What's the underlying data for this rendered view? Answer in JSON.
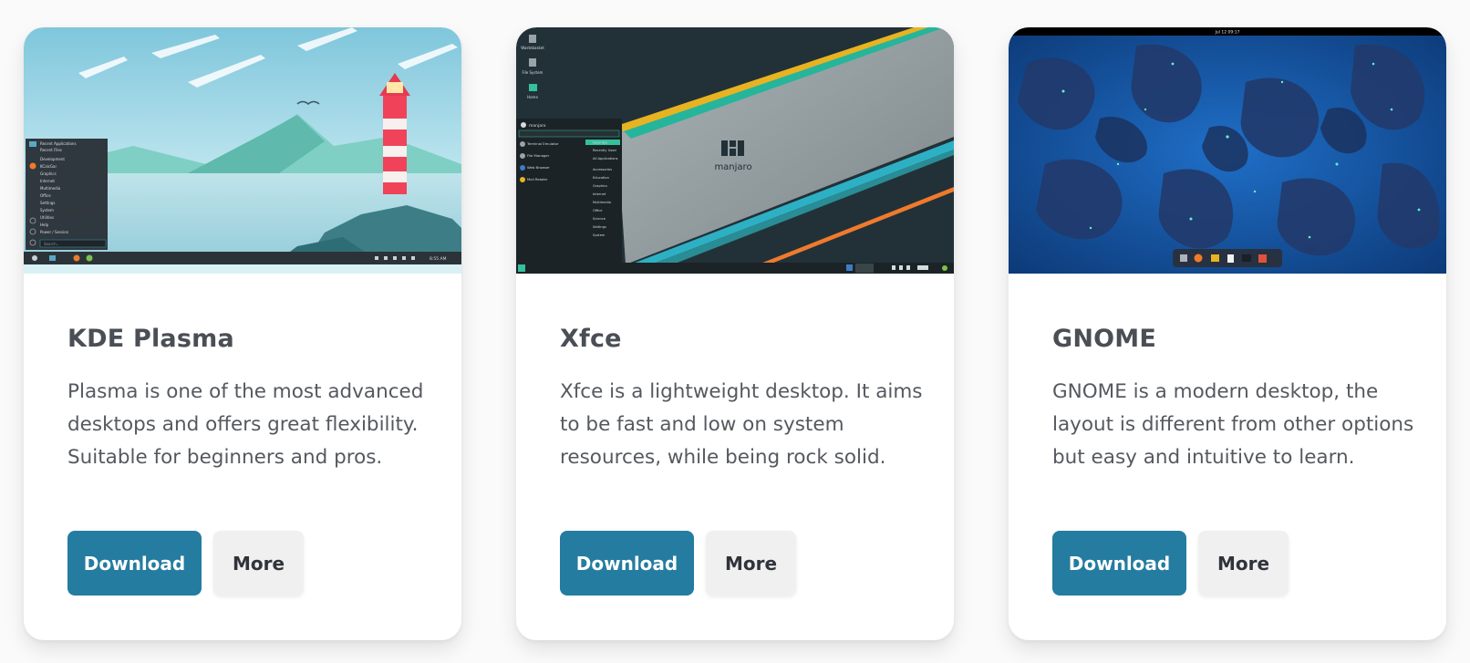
{
  "cards": [
    {
      "title": "KDE Plasma",
      "description": "Plasma is one of the most advanced desktops and offers great flexibility. Suitable for beginners and pros.",
      "download_label": "Download",
      "more_label": "More",
      "screenshot": {
        "menu_items": [
          "Recent Applications",
          "Recent Files",
          "Development",
          "KCalcGar",
          "Graphics",
          "Internet",
          "Multimedia",
          "Office",
          "Settings",
          "System",
          "Utilities",
          "Help",
          "Power / Session"
        ],
        "search_placeholder": "Search...",
        "clock": "8:55 AM"
      }
    },
    {
      "title": "Xfce",
      "description": "Xfce is a lightweight desktop. It aims to be fast and low on system resources, while being rock solid.",
      "download_label": "Download",
      "more_label": "More",
      "screenshot": {
        "desktop_icons": [
          "Wastebasket",
          "File System",
          "Home"
        ],
        "logo_text": "manjaro",
        "menu_user": "manjaro",
        "favorites": [
          "Terminal Emulator",
          "File Manager",
          "Web Browser",
          "Mail Reader"
        ],
        "categories": [
          "Favorites",
          "Recently Used",
          "All Applications",
          "Accessories",
          "Education",
          "Graphics",
          "Internet",
          "Multimedia",
          "Office",
          "Science",
          "Settings",
          "System"
        ]
      }
    },
    {
      "title": "GNOME",
      "description": "GNOME is a modern desktop, the layout is different from other options but easy and intuitive to learn.",
      "download_label": "Download",
      "more_label": "More",
      "screenshot": {
        "clock": "Jul 12 09:17"
      }
    }
  ],
  "colors": {
    "download_bg": "#247ca0",
    "more_bg": "#f0f0f0",
    "title_text": "#4a4e55",
    "body_text": "#55595f"
  }
}
